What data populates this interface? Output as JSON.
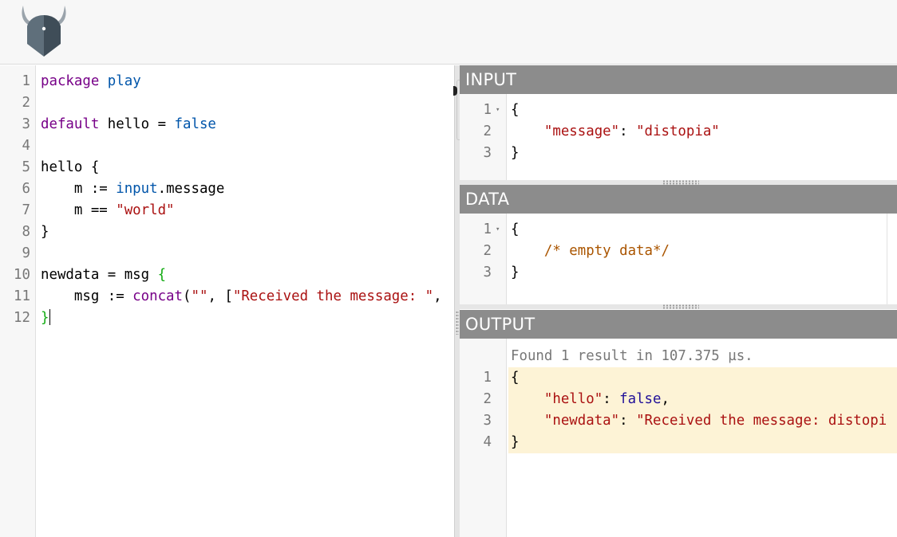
{
  "app": {
    "logo_icon": "opa-viking-helmet-icon"
  },
  "editor": {
    "lines": [
      {
        "num": "1",
        "segs": [
          {
            "t": "package",
            "c": "kw"
          },
          {
            "t": " "
          },
          {
            "t": "play",
            "c": "vr"
          }
        ]
      },
      {
        "num": "2",
        "segs": []
      },
      {
        "num": "3",
        "segs": [
          {
            "t": "default",
            "c": "kw"
          },
          {
            "t": " hello = "
          },
          {
            "t": "false",
            "c": "vr"
          }
        ]
      },
      {
        "num": "4",
        "segs": []
      },
      {
        "num": "5",
        "segs": [
          {
            "t": "hello {"
          }
        ]
      },
      {
        "num": "6",
        "segs": [
          {
            "t": "    m := "
          },
          {
            "t": "input",
            "c": "vr"
          },
          {
            "t": ".message"
          }
        ]
      },
      {
        "num": "7",
        "segs": [
          {
            "t": "    m == "
          },
          {
            "t": "\"world\"",
            "c": "str"
          }
        ]
      },
      {
        "num": "8",
        "segs": [
          {
            "t": "}"
          }
        ]
      },
      {
        "num": "9",
        "segs": []
      },
      {
        "num": "10",
        "segs": [
          {
            "t": "newdata = msg "
          },
          {
            "t": "{",
            "c": "brk"
          }
        ]
      },
      {
        "num": "11",
        "segs": [
          {
            "t": "    msg := "
          },
          {
            "t": "concat",
            "c": "kw"
          },
          {
            "t": "("
          },
          {
            "t": "\"\"",
            "c": "str"
          },
          {
            "t": ", ["
          },
          {
            "t": "\"Received the message: \"",
            "c": "str"
          },
          {
            "t": ","
          }
        ]
      },
      {
        "num": "12",
        "segs": [
          {
            "t": "}",
            "c": "brk"
          }
        ]
      }
    ]
  },
  "input_panel": {
    "title": "INPUT",
    "lines": [
      {
        "num": "1",
        "fold": "▾",
        "segs": [
          {
            "t": "{"
          }
        ]
      },
      {
        "num": "2",
        "segs": [
          {
            "t": "    "
          },
          {
            "t": "\"message\"",
            "c": "str"
          },
          {
            "t": ": "
          },
          {
            "t": "\"distopia\"",
            "c": "str"
          }
        ]
      },
      {
        "num": "3",
        "segs": [
          {
            "t": "}"
          }
        ]
      }
    ]
  },
  "data_panel": {
    "title": "DATA",
    "lines": [
      {
        "num": "1",
        "fold": "▾",
        "segs": [
          {
            "t": "{"
          }
        ]
      },
      {
        "num": "2",
        "segs": [
          {
            "t": "    "
          },
          {
            "t": "/* empty data*/",
            "c": "cmt"
          }
        ]
      },
      {
        "num": "3",
        "segs": [
          {
            "t": "}"
          }
        ]
      }
    ]
  },
  "output_panel": {
    "title": "OUTPUT",
    "status": "Found 1 result in 107.375 µs.",
    "lines": [
      {
        "num": "1",
        "segs": [
          {
            "t": "{"
          }
        ]
      },
      {
        "num": "2",
        "segs": [
          {
            "t": "    "
          },
          {
            "t": "\"hello\"",
            "c": "str"
          },
          {
            "t": ": "
          },
          {
            "t": "false",
            "c": "atom"
          },
          {
            "t": ","
          }
        ]
      },
      {
        "num": "3",
        "segs": [
          {
            "t": "    "
          },
          {
            "t": "\"newdata\"",
            "c": "str"
          },
          {
            "t": ": "
          },
          {
            "t": "\"Received the message: distopi",
            "c": "str"
          }
        ]
      },
      {
        "num": "4",
        "segs": [
          {
            "t": "}"
          }
        ]
      }
    ]
  },
  "colors": {
    "keyword": "#770088",
    "variable": "#0055aa",
    "string": "#aa1111",
    "bracket": "#11aa11",
    "comment": "#aa5500",
    "panel_header": "#8c8c8c",
    "highlight": "#fdf3d6"
  }
}
